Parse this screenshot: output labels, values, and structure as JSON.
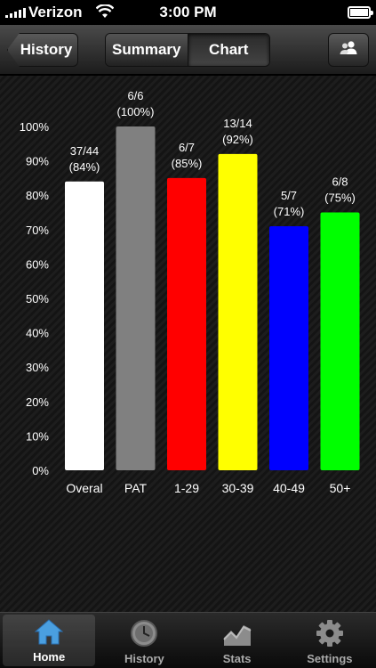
{
  "status_bar": {
    "carrier": "Verizon",
    "time": "3:00 PM"
  },
  "nav": {
    "back_label": "History",
    "segments": [
      "Summary",
      "Chart"
    ],
    "selected_segment": "Chart",
    "share_icon": "contacts-icon"
  },
  "tabs": [
    {
      "label": "Home",
      "icon": "home-icon",
      "active": true
    },
    {
      "label": "History",
      "icon": "clock-icon",
      "active": false
    },
    {
      "label": "Stats",
      "icon": "chart-icon",
      "active": false
    },
    {
      "label": "Settings",
      "icon": "gear-icon",
      "active": false
    }
  ],
  "colors": {
    "home_icon": "#4a9fe0"
  },
  "chart_data": {
    "type": "bar",
    "categories": [
      "Overal",
      "PAT",
      "1-29",
      "30-39",
      "40-49",
      "50+"
    ],
    "values": [
      84,
      100,
      85,
      92,
      71,
      75
    ],
    "count_labels": [
      "37/44",
      "6/6",
      "6/7",
      "13/14",
      "5/7",
      "6/8"
    ],
    "percent_labels": [
      "(84%)",
      "(100%)",
      "(85%)",
      "(92%)",
      "(71%)",
      "(75%)"
    ],
    "colors": [
      "#ffffff",
      "#808080",
      "#ff0000",
      "#ffff00",
      "#0000ff",
      "#00ff00"
    ],
    "ylim": [
      0,
      100
    ],
    "yticks": [
      "0%",
      "10%",
      "20%",
      "30%",
      "40%",
      "50%",
      "60%",
      "70%",
      "80%",
      "90%",
      "100%"
    ],
    "xlabel": "",
    "ylabel": "",
    "title": ""
  }
}
